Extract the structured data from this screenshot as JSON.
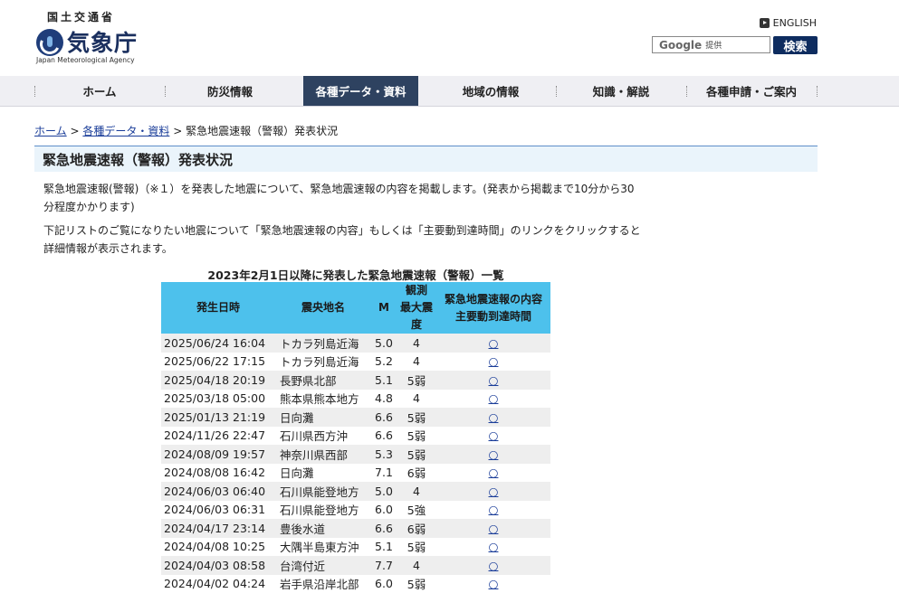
{
  "header": {
    "ministry": "国土交通省",
    "agency_name": "気象庁",
    "agency_en": "Japan Meteorological Agency",
    "english_link": "ENGLISH",
    "search_brand": "Google",
    "search_sub": "提供",
    "search_button": "検索"
  },
  "nav": {
    "items": [
      {
        "label": "ホーム"
      },
      {
        "label": "防災情報"
      },
      {
        "label": "各種データ・資料"
      },
      {
        "label": "地域の情報"
      },
      {
        "label": "知識・解説"
      },
      {
        "label": "各種申請・ご案内"
      }
    ],
    "active_index": 2
  },
  "breadcrumb": {
    "home": "ホーム",
    "sep": ">",
    "data": "各種データ・資料",
    "current": "緊急地震速報（警報）発表状況"
  },
  "page": {
    "title": "緊急地震速報（警報）発表状況",
    "para1_line1": "緊急地震速報(警報)（※１）を発表した地震について、緊急地震速報の内容を掲載します。(発表から掲載まで10分から30",
    "para1_line2": "分程度かかります)",
    "para2_line1": "下記リストのご覧になりたい地震について「緊急地震速報の内容」もしくは「主要動到達時間」のリンクをクリックすると",
    "para2_line2": "詳細情報が表示されます。"
  },
  "table": {
    "caption": "2023年2月1日以降に発表した緊急地震速報（警報）一覧",
    "headers": {
      "date": "発生日時",
      "place": "震央地名",
      "mag": "M",
      "int_line1": "観測",
      "int_line2": "最大震度",
      "link_line1": "緊急地震速報の内容",
      "link_line2": "主要動到達時間"
    },
    "rows": [
      {
        "date": "2025/06/24 16:04",
        "place": "トカラ列島近海",
        "mag": "5.0",
        "intensity": "4",
        "link": "○"
      },
      {
        "date": "2025/06/22 17:15",
        "place": "トカラ列島近海",
        "mag": "5.2",
        "intensity": "4",
        "link": "○"
      },
      {
        "date": "2025/04/18 20:19",
        "place": "長野県北部",
        "mag": "5.1",
        "intensity": "5弱",
        "link": "○"
      },
      {
        "date": "2025/03/18 05:00",
        "place": "熊本県熊本地方",
        "mag": "4.8",
        "intensity": "4",
        "link": "○"
      },
      {
        "date": "2025/01/13 21:19",
        "place": "日向灘",
        "mag": "6.6",
        "intensity": "5弱",
        "link": "○"
      },
      {
        "date": "2024/11/26 22:47",
        "place": "石川県西方沖",
        "mag": "6.6",
        "intensity": "5弱",
        "link": "○"
      },
      {
        "date": "2024/08/09 19:57",
        "place": "神奈川県西部",
        "mag": "5.3",
        "intensity": "5弱",
        "link": "○"
      },
      {
        "date": "2024/08/08 16:42",
        "place": "日向灘",
        "mag": "7.1",
        "intensity": "6弱",
        "link": "○"
      },
      {
        "date": "2024/06/03 06:40",
        "place": "石川県能登地方",
        "mag": "5.0",
        "intensity": "4",
        "link": "○"
      },
      {
        "date": "2024/06/03 06:31",
        "place": "石川県能登地方",
        "mag": "6.0",
        "intensity": "5強",
        "link": "○"
      },
      {
        "date": "2024/04/17 23:14",
        "place": "豊後水道",
        "mag": "6.6",
        "intensity": "6弱",
        "link": "○"
      },
      {
        "date": "2024/04/08 10:25",
        "place": "大隅半島東方沖",
        "mag": "5.1",
        "intensity": "5弱",
        "link": "○"
      },
      {
        "date": "2024/04/03 08:58",
        "place": "台湾付近",
        "mag": "7.7",
        "intensity": "4",
        "link": "○"
      },
      {
        "date": "2024/04/02 04:24",
        "place": "岩手県沿岸北部",
        "mag": "6.0",
        "intensity": "5弱",
        "link": "○"
      }
    ]
  },
  "icons": {
    "english": "play-triangle-icon",
    "logo": "jma-logo-icon"
  }
}
